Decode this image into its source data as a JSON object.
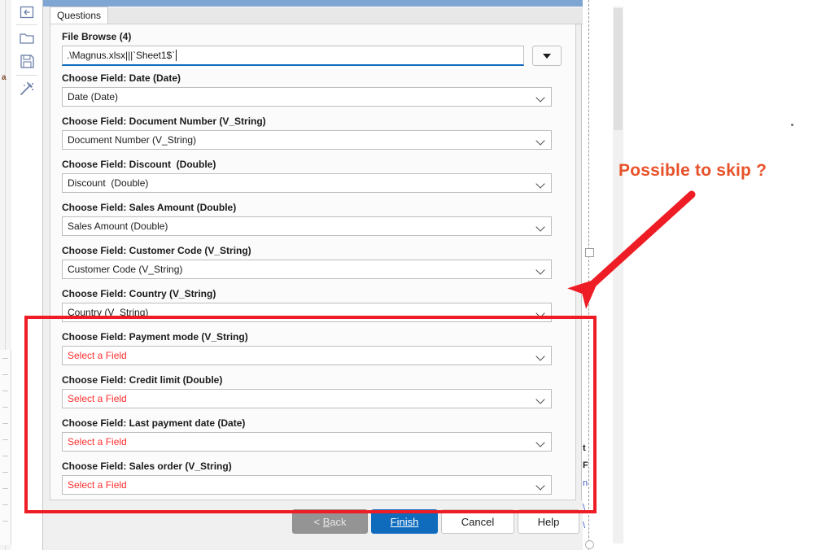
{
  "window": {
    "tab_label": "Questions"
  },
  "left_toolbar": {
    "items": [
      {
        "icon": "back-arrow-boxed-icon"
      },
      {
        "icon": "folder-icon"
      },
      {
        "icon": "save-floppy-icon"
      },
      {
        "icon": "magic-wand-icon"
      }
    ]
  },
  "file_browse": {
    "label": "File Browse (4)",
    "value": ".\\Magnus.xlsx|||`Sheet1$`",
    "dropdown_icon": "triangle-down-icon"
  },
  "fields": [
    {
      "label": "Choose Field: Date (Date)",
      "value": "Date (Date)",
      "is_placeholder": false,
      "highlighted": false
    },
    {
      "label": "Choose Field: Document Number (V_String)",
      "value": "Document Number (V_String)",
      "is_placeholder": false,
      "highlighted": false
    },
    {
      "label": "Choose Field: Discount  (Double)",
      "value": "Discount  (Double)",
      "is_placeholder": false,
      "highlighted": false
    },
    {
      "label": "Choose Field: Sales Amount (Double)",
      "value": "Sales Amount (Double)",
      "is_placeholder": false,
      "highlighted": false
    },
    {
      "label": "Choose Field: Customer Code (V_String)",
      "value": "Customer Code (V_String)",
      "is_placeholder": false,
      "highlighted": false
    },
    {
      "label": "Choose Field: Country (V_String)",
      "value": "Country (V_String)",
      "is_placeholder": false,
      "highlighted": false
    },
    {
      "label": "Choose Field: Payment mode (V_String)",
      "value": "Select a Field",
      "is_placeholder": true,
      "highlighted": true
    },
    {
      "label": "Choose Field: Credit limit (Double)",
      "value": "Select a Field",
      "is_placeholder": true,
      "highlighted": true
    },
    {
      "label": "Choose Field: Last payment date (Date)",
      "value": "Select a Field",
      "is_placeholder": true,
      "highlighted": true
    },
    {
      "label": "Choose Field: Sales order (V_String)",
      "value": "Select a Field",
      "is_placeholder": true,
      "highlighted": true
    }
  ],
  "footer": {
    "back_label": "< Back",
    "back_accel": "B",
    "finish_label": "Finish",
    "finish_accel": "F",
    "cancel_label": "Cancel",
    "help_label": "Help",
    "back_disabled": true
  },
  "annotation": {
    "text": "Possible to skip ?",
    "text_color": "#e8522a",
    "arrow_color": "#ee1c25",
    "rect_color": "#ee1c25"
  },
  "colors": {
    "accent_blue": "#0f6cbd",
    "placeholder_red": "#ff2d2d",
    "titlebar_blue": "#7fa6d3",
    "dialog_bg": "#f0f0f0",
    "panel_bg": "#fbfbfb"
  }
}
